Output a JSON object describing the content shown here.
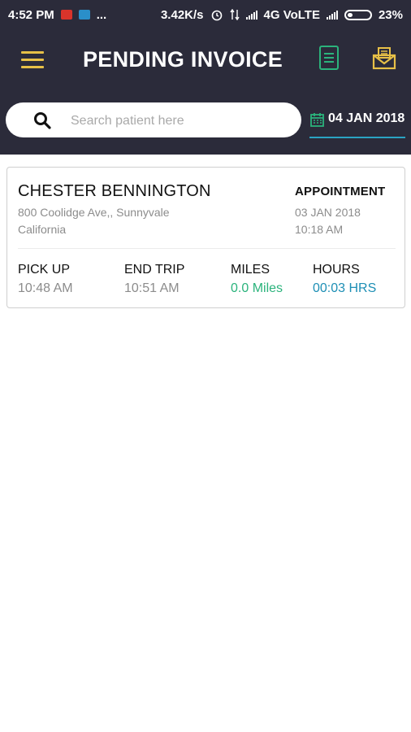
{
  "status_bar": {
    "time": "4:52 PM",
    "more": "...",
    "speed": "3.42K/s",
    "network": "4G VoLTE",
    "battery": "23%"
  },
  "header": {
    "title": "PENDING INVOICE",
    "icons": [
      "menu-icon",
      "document-icon",
      "mail-icon"
    ]
  },
  "search": {
    "placeholder": "Search patient here",
    "value": ""
  },
  "date_filter": {
    "value": "04 JAN 2018"
  },
  "invoice": {
    "patient_name": "CHESTER BENNINGTON",
    "address_line1": "800 Coolidge Ave,, Sunnyvale",
    "address_line2": "California",
    "appointment_label": "APPOINTMENT",
    "appointment_date": "03 JAN 2018",
    "appointment_time": "10:18 AM",
    "pickup_label": "PICK UP",
    "pickup_time": "10:48 AM",
    "endtrip_label": "END TRIP",
    "endtrip_time": "10:51 AM",
    "miles_label": "MILES",
    "miles_value": "0.0 Miles",
    "hours_label": "HOURS",
    "hours_value": "00:03 HRS"
  },
  "colors": {
    "header_bg": "#2b2b3a",
    "accent_yellow": "#e7c047",
    "accent_green": "#2bb37c",
    "accent_blue": "#1e8fb5"
  }
}
